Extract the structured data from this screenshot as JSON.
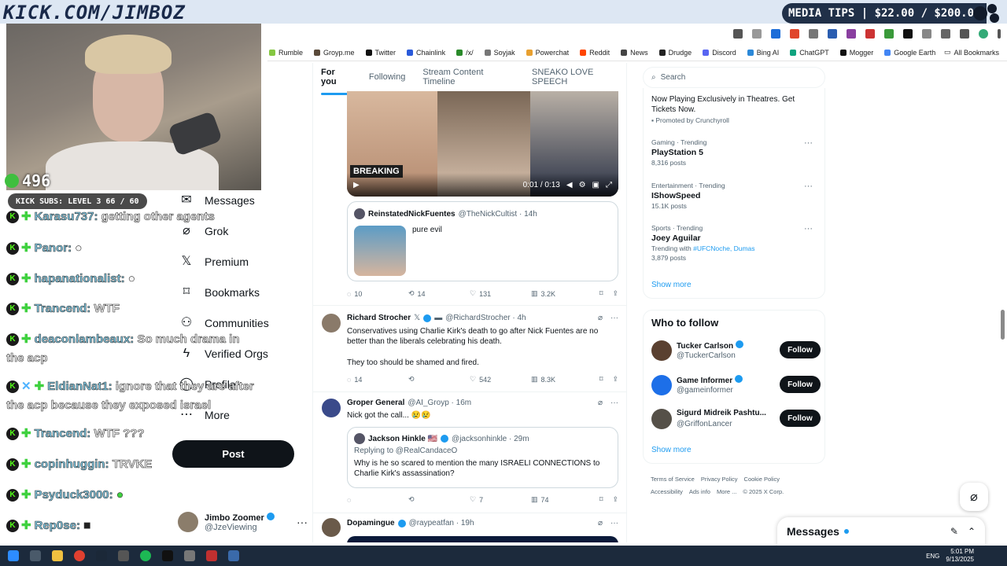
{
  "overlay": {
    "brand": "KICK.COM/JIMBOZ",
    "media_tips": "MEDIA TIPS | $22.00 / $200.00",
    "viewers": "496",
    "subs": "KICK SUBS: LEVEL 3 66 / 60"
  },
  "chat": [
    {
      "user": "Karasu737:",
      "msg": "getting other agents"
    },
    {
      "user": "Panor:",
      "msg": ""
    },
    {
      "user": "hapanationalist:",
      "msg": ""
    },
    {
      "user": "Trancend:",
      "msg": "WTF"
    },
    {
      "user": "deaconlambeaux:",
      "msg": "So much drama in the acp"
    },
    {
      "user": "EldianNat1:",
      "msg": "ignore that they are after the acp because they exposed israel"
    },
    {
      "user": "Trancend:",
      "msg": "WTF ???"
    },
    {
      "user": "copinhuggin:",
      "msg": "TRVKE"
    },
    {
      "user": "Psyduck3000:",
      "msg": ""
    },
    {
      "user": "Rep0se:",
      "msg": ""
    }
  ],
  "bookmarks": [
    "Rumble",
    "Groyp.me",
    "Twitter",
    "Chainlink",
    "/x/",
    "Soyjak",
    "Powerchat",
    "Reddit",
    "News",
    "Drudge",
    "Discord",
    "Bing AI",
    "ChatGPT",
    "Mogger",
    "Google Earth"
  ],
  "bookmarks_all": "All Bookmarks",
  "nav": {
    "messages": "Messages",
    "grok": "Grok",
    "premium": "Premium",
    "bookmarks": "Bookmarks",
    "communities": "Communities",
    "verified_orgs": "Verified Orgs",
    "profile": "Profile",
    "more": "More",
    "post": "Post"
  },
  "account": {
    "name": "Jimbo Zoomer",
    "handle": "@JzeViewing"
  },
  "tabs": [
    "For you",
    "Following",
    "Stream Content Timeline",
    "SNEAKO LOVE SPEECH"
  ],
  "video": {
    "banner": "BREAKING",
    "time": "0:01 / 0:13"
  },
  "quote1": {
    "name": "ReinstatedNickFuentes",
    "handle": "@TheNickCultist · 14h",
    "text": "pure evil"
  },
  "post1_actions": {
    "replies": "10",
    "reposts": "14",
    "likes": "131",
    "views": "3.2K"
  },
  "post2": {
    "name": "Richard Strocher",
    "handle": "@RichardStrocher · 4h",
    "text1": "Conservatives using Charlie Kirk's death to go after Nick Fuentes are no better than the liberals celebrating his death.",
    "text2": "They too should be shamed and fired.",
    "replies": "14",
    "reposts": "",
    "likes": "542",
    "views": "8.3K"
  },
  "post3": {
    "name": "Groper General",
    "handle": "@AI_Groyp · 16m",
    "text": "Nick got the call... 😢😢",
    "quote_name": "Jackson Hinkle 🇺🇸",
    "quote_handle": "@jacksonhinkle · 29m",
    "quote_reply": "Replying to @RealCandaceO",
    "quote_text": "Why is he so scared to mention the many ISRAELI CONNECTIONS to Charlie Kirk's assassination?",
    "replies": "",
    "reposts": "",
    "likes": "7",
    "views": "74"
  },
  "post4": {
    "name": "Dopamingue",
    "handle": "@raypeatfan · 19h"
  },
  "search": {
    "placeholder": "Search"
  },
  "promo": {
    "text": "Now Playing Exclusively in Theatres. Get Tickets Now.",
    "by": "Promoted by Crunchyroll"
  },
  "trends": [
    {
      "cat": "Gaming · Trending",
      "title": "PlayStation 5",
      "count": "8,316 posts",
      "with": ""
    },
    {
      "cat": "Entertainment · Trending",
      "title": "IShowSpeed",
      "count": "15.1K posts",
      "with": ""
    },
    {
      "cat": "Sports · Trending",
      "title": "Joey Aguilar",
      "count": "3,879 posts",
      "with": "Trending with",
      "tags": "#UFCNoche, Dumas"
    }
  ],
  "show_more": "Show more",
  "who_to_follow": {
    "title": "Who to follow",
    "people": [
      {
        "name": "Tucker Carlson",
        "handle": "@TuckerCarlson"
      },
      {
        "name": "Game Informer",
        "handle": "@gameinformer"
      },
      {
        "name": "Sigurd Midreik Pashtu...",
        "handle": "@GriffonLancer"
      }
    ],
    "follow": "Follow"
  },
  "footer": [
    "Terms of Service",
    "Privacy Policy",
    "Cookie Policy",
    "Accessibility",
    "Ads info",
    "More ...",
    "© 2025 X Corp."
  ],
  "messages_drawer": "Messages",
  "taskbar": {
    "lang": "ENG",
    "time": "5:01 PM",
    "date": "9/13/2025"
  },
  "colors": {
    "accent": "#1d9bf0",
    "kick_green": "#53fc18"
  }
}
